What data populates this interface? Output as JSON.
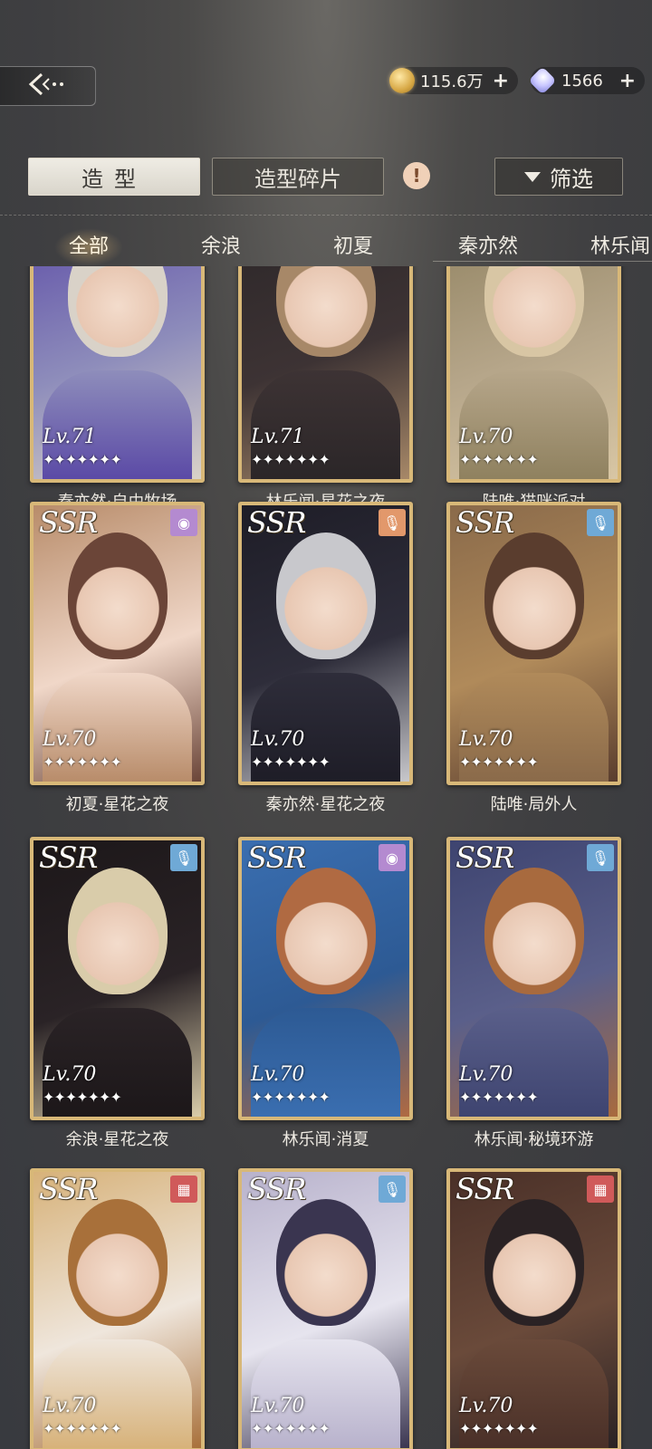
{
  "header": {
    "currency_gold": "115.6万",
    "currency_gem": "1566",
    "plus": "+"
  },
  "tabs": {
    "style": "造型",
    "fragments": "造型碎片",
    "alert": "!",
    "filter": "筛选"
  },
  "characters": [
    "全部",
    "余浪",
    "初夏",
    "秦亦然",
    "林乐闻"
  ],
  "cards": [
    {
      "name": "秦亦然·自由牧场",
      "rarity": "",
      "level": "Lv.71",
      "stars": "✦✦✦✦✦✦✦",
      "icon": "",
      "palette": [
        "#d9d2c8",
        "#8e8dbb",
        "#5b4aa6"
      ]
    },
    {
      "name": "林乐闻·星花之夜",
      "rarity": "",
      "level": "Lv.71",
      "stars": "✦✦✦✦✦✦✦",
      "icon": "",
      "palette": [
        "#a78868",
        "#3d3334",
        "#2b2628"
      ]
    },
    {
      "name": "陆唯·猫咪派对",
      "rarity": "",
      "level": "Lv.70",
      "stars": "✦✦✦✦✦✦✦",
      "icon": "",
      "palette": [
        "#d8c6a4",
        "#b6a68a",
        "#8f815f"
      ]
    },
    {
      "name": "初夏·星花之夜",
      "rarity": "SSR",
      "level": "Lv.70",
      "stars": "✦✦✦✦✦✦✦",
      "icon": "record-icon",
      "iconColor": "#b48ad0",
      "palette": [
        "#6b4538",
        "#f0d7c8",
        "#b88c6a"
      ]
    },
    {
      "name": "秦亦然·星花之夜",
      "rarity": "SSR",
      "level": "Lv.70",
      "stars": "✦✦✦✦✦✦✦",
      "icon": "mic-icon",
      "iconColor": "#e2986b",
      "palette": [
        "#c8c8cc",
        "#2e2d3a",
        "#1e1d27"
      ]
    },
    {
      "name": "陆唯·局外人",
      "rarity": "SSR",
      "level": "Lv.70",
      "stars": "✦✦✦✦✦✦✦",
      "icon": "mic-icon",
      "iconColor": "#6fa9d6",
      "palette": [
        "#5a3d2e",
        "#b08a5a",
        "#8a6a4a"
      ]
    },
    {
      "name": "余浪·星花之夜",
      "rarity": "SSR",
      "level": "Lv.70",
      "stars": "✦✦✦✦✦✦✦",
      "icon": "mic-icon",
      "iconColor": "#6fa9d6",
      "palette": [
        "#d9ccaa",
        "#2a2326",
        "#1c1719"
      ]
    },
    {
      "name": "林乐闻·消夏",
      "rarity": "SSR",
      "level": "Lv.70",
      "stars": "✦✦✦✦✦✦✦",
      "icon": "record-icon",
      "iconColor": "#b48ad0",
      "palette": [
        "#b06a42",
        "#2d5a94",
        "#3a6eb0"
      ]
    },
    {
      "name": "林乐闻·秘境环游",
      "rarity": "SSR",
      "level": "Lv.70",
      "stars": "✦✦✦✦✦✦✦",
      "icon": "mic-icon",
      "iconColor": "#6fa9d6",
      "palette": [
        "#a86a3e",
        "#5a5f8a",
        "#3e4470"
      ]
    },
    {
      "name": "",
      "rarity": "SSR",
      "level": "Lv.70",
      "stars": "✦✦✦✦✦✦✦",
      "icon": "film-icon",
      "iconColor": "#d05a5a",
      "palette": [
        "#a8703a",
        "#efe6dc",
        "#d7b27a"
      ]
    },
    {
      "name": "",
      "rarity": "SSR",
      "level": "Lv.70",
      "stars": "✦✦✦✦✦✦✦",
      "icon": "mic-icon",
      "iconColor": "#6fa9d6",
      "palette": [
        "#3a3550",
        "#e6e4ee",
        "#b8b2cc"
      ]
    },
    {
      "name": "",
      "rarity": "SSR",
      "level": "Lv.70",
      "stars": "✦✦✦✦✦✦✦",
      "icon": "film-icon",
      "iconColor": "#d05a5a",
      "palette": [
        "#2a2224",
        "#6a4a3a",
        "#4a3028"
      ]
    }
  ]
}
